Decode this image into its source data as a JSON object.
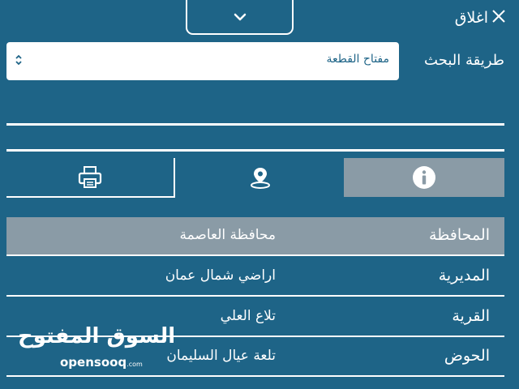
{
  "header": {
    "close_label": "اغلاق"
  },
  "search": {
    "label": "طريقة البحث",
    "selected": "مفتاح القطعة"
  },
  "tabs": [
    {
      "icon": "info-icon",
      "active": true
    },
    {
      "icon": "map-pin-icon",
      "active": false
    },
    {
      "icon": "printer-icon",
      "active": false
    }
  ],
  "details": [
    {
      "key": "المحافظة",
      "value": "محافظة العاصمة",
      "highlighted": true
    },
    {
      "key": "المديرية",
      "value": "اراضي شمال عمان",
      "highlighted": false
    },
    {
      "key": "القرية",
      "value": "تلاع العلي",
      "highlighted": false
    },
    {
      "key": "الحوض",
      "value": "تلعة عيال السليمان",
      "highlighted": false
    }
  ],
  "watermark": {
    "arabic": "السوق المفتوح",
    "english": "opensooq",
    "suffix": ".com"
  },
  "colors": {
    "background": "#1e6487",
    "active_tab": "#8a9ba6",
    "highlight_row": "#8a9ba6",
    "select_text": "#1e6487"
  }
}
